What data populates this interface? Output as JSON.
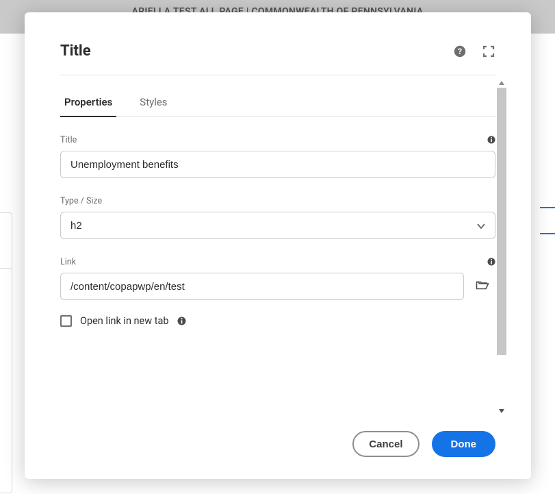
{
  "page_banner": "ARIELLA TEST ALL PAGE | COMMONWEALTH OF PENNSYLVANIA",
  "dialog": {
    "title": "Title",
    "tabs": {
      "properties": "Properties",
      "styles": "Styles"
    },
    "fields": {
      "title_label": "Title",
      "title_value": "Unemployment benefits",
      "type_label": "Type / Size",
      "type_value": "h2",
      "link_label": "Link",
      "link_value": "/content/copapwp/en/test",
      "new_tab_label": "Open link in new tab"
    },
    "footer": {
      "cancel": "Cancel",
      "done": "Done"
    }
  }
}
